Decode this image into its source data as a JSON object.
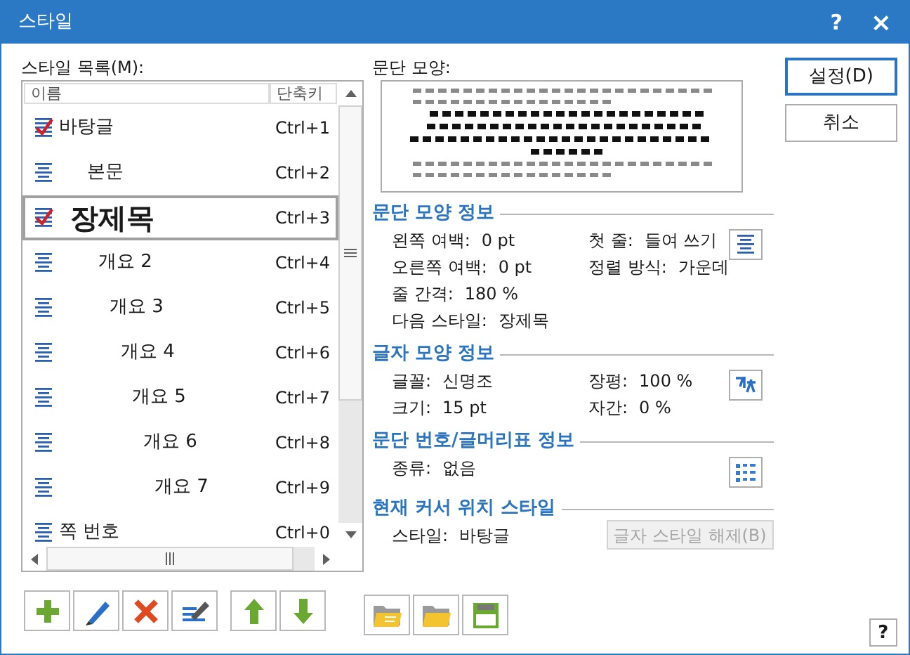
{
  "window": {
    "title": "스타일",
    "help": "?",
    "close": "×"
  },
  "style_list": {
    "label": "스타일 목록(M):",
    "columns": [
      "이름",
      "단축키"
    ],
    "rows": [
      {
        "name": "바탕글",
        "shortcut": "Ctrl+1",
        "kind": "checked",
        "selected": false
      },
      {
        "name": "본문",
        "shortcut": "Ctrl+2",
        "kind": "paragraph",
        "selected": false
      },
      {
        "name": "장제목",
        "shortcut": "Ctrl+3",
        "kind": "checked",
        "selected": true
      },
      {
        "name": "개요 2",
        "shortcut": "Ctrl+4",
        "kind": "paragraph",
        "selected": false
      },
      {
        "name": "개요 3",
        "shortcut": "Ctrl+5",
        "kind": "paragraph",
        "selected": false
      },
      {
        "name": "개요 4",
        "shortcut": "Ctrl+6",
        "kind": "paragraph",
        "selected": false
      },
      {
        "name": "개요 5",
        "shortcut": "Ctrl+7",
        "kind": "paragraph",
        "selected": false
      },
      {
        "name": "개요 6",
        "shortcut": "Ctrl+8",
        "kind": "paragraph",
        "selected": false
      },
      {
        "name": "개요 7",
        "shortcut": "Ctrl+9",
        "kind": "paragraph",
        "selected": false
      },
      {
        "name": "쪽 번호",
        "shortcut": "Ctrl+0",
        "kind": "paragraph",
        "selected": false
      }
    ]
  },
  "preview": {
    "label": "문단 모양:"
  },
  "sections": [
    {
      "title": "문단 모양 정보",
      "kind": "align",
      "rows": [
        [
          {
            "label": "왼쪽 여백:",
            "value": "0 pt"
          },
          {
            "label": "첫 줄:",
            "value": "들여 쓰기"
          }
        ],
        [
          {
            "label": "오른쪽 여백:",
            "value": "0 pt"
          },
          {
            "label": "정렬 방식:",
            "value": "가운데"
          }
        ],
        [
          {
            "label": "줄 간격:",
            "value": "180 %"
          }
        ],
        [
          {
            "label": "다음 스타일:",
            "value": "장제목"
          }
        ]
      ]
    },
    {
      "title": "글자 모양 정보",
      "kind": "font",
      "rows": [
        [
          {
            "label": "글꼴:",
            "value": "신명조"
          },
          {
            "label": "장평:",
            "value": "100 %"
          }
        ],
        [
          {
            "label": "크기:",
            "value": "15 pt"
          },
          {
            "label": "자간:",
            "value": "0 %"
          }
        ]
      ]
    },
    {
      "title": "문단 번호/글머리표 정보",
      "kind": "list",
      "rows": [
        [
          {
            "label": "종류:",
            "value": "없음"
          }
        ]
      ]
    },
    {
      "title": "현재 커서 위치 스타일",
      "kind": "cursor",
      "rows": [
        [
          {
            "label": "스타일:",
            "value": "바탕글"
          }
        ]
      ],
      "button": {
        "label": "글자 스타일 해제(B)",
        "disabled": true
      }
    }
  ],
  "buttons": [
    {
      "label": "설정(D)",
      "default": true
    },
    {
      "label": "취소",
      "default": false
    }
  ],
  "help_button": "?"
}
